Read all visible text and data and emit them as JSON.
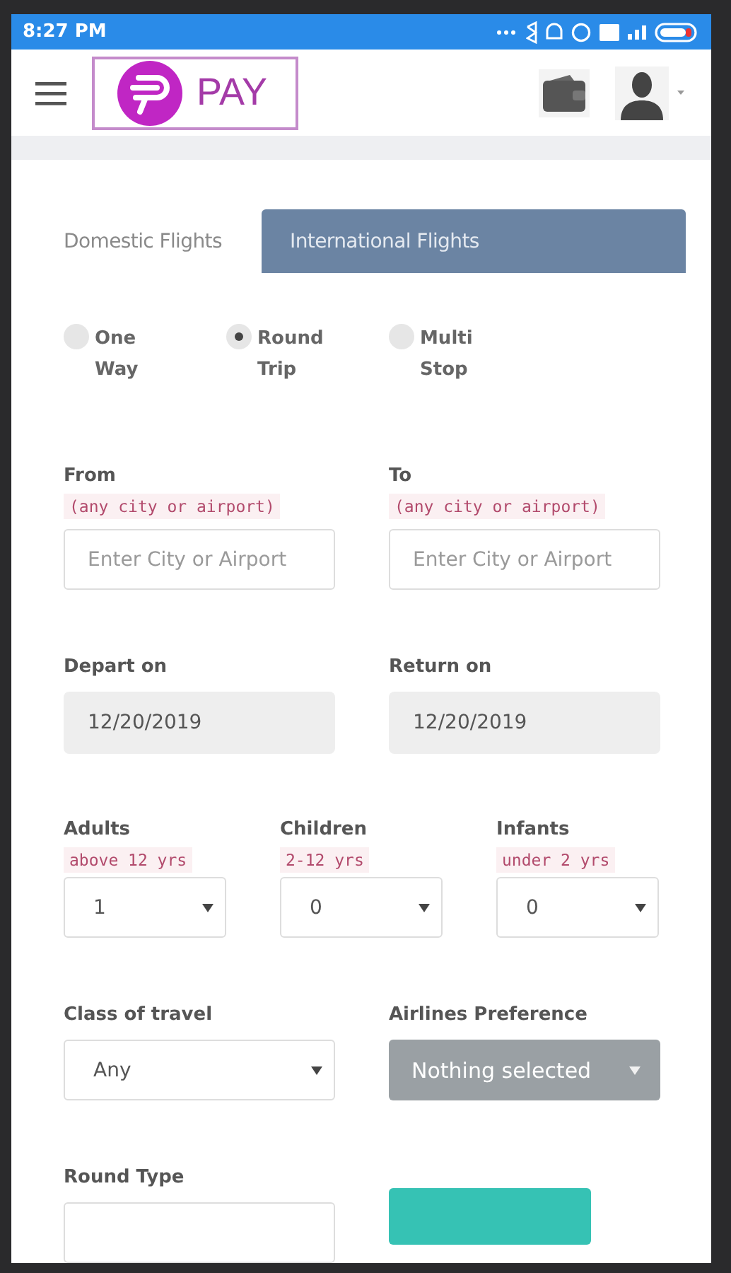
{
  "status_bar": {
    "time": "8:27 PM"
  },
  "header": {
    "logo_text": "PAY"
  },
  "tabs": [
    {
      "label": "Domestic Flights",
      "selected": false
    },
    {
      "label": "International Flights",
      "selected": true
    }
  ],
  "trip_types": [
    {
      "label": "One Way",
      "selected": false
    },
    {
      "label": "Round Trip",
      "selected": true
    },
    {
      "label": "Multi Stop",
      "selected": false
    }
  ],
  "locations": [
    {
      "label": "From",
      "hint": "(any city or airport)",
      "placeholder": "Enter City or Airport"
    },
    {
      "label": "To",
      "hint": "(any city or airport)",
      "placeholder": "Enter City or Airport"
    }
  ],
  "dates": [
    {
      "label": "Depart on",
      "value": "12/20/2019"
    },
    {
      "label": "Return on",
      "value": "12/20/2019"
    }
  ],
  "passengers": [
    {
      "label": "Adults",
      "hint": "above 12 yrs",
      "value": "1"
    },
    {
      "label": "Children",
      "hint": "2-12 yrs",
      "value": "0"
    },
    {
      "label": "Infants",
      "hint": "under 2 yrs",
      "value": "0"
    }
  ],
  "class_of_travel": {
    "label": "Class of travel",
    "value": "Any"
  },
  "airlines_preference": {
    "label": "Airlines Preference",
    "value": "Nothing selected"
  },
  "round_type": {
    "label": "Round Type"
  }
}
